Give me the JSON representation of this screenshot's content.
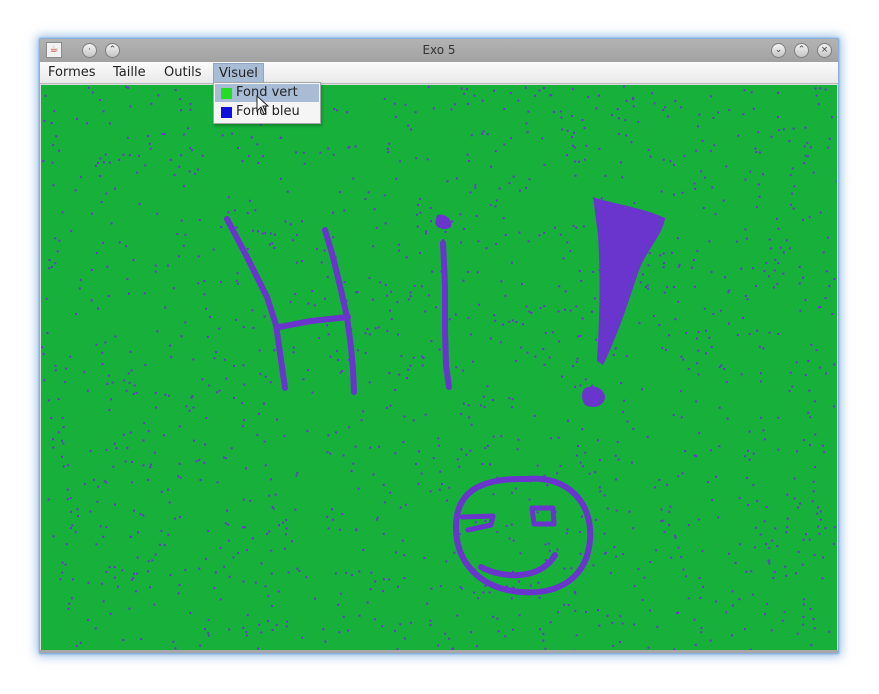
{
  "window": {
    "title": "Exo 5",
    "app_icon": "java-icon",
    "controls_left": [
      "window-menu-icon",
      "keep-above-icon"
    ],
    "controls_right": [
      "minimize-icon",
      "maximize-icon",
      "close-icon"
    ]
  },
  "menubar": {
    "items": [
      {
        "label": "Formes"
      },
      {
        "label": "Taille"
      },
      {
        "label": "Outils"
      },
      {
        "label": "Visuel",
        "active": true
      }
    ]
  },
  "dropdown": {
    "items": [
      {
        "label": "Fond vert",
        "swatch_color": "#22dd22",
        "highlighted": true
      },
      {
        "label": "Fond bleu",
        "swatch_color": "#1111dd",
        "highlighted": false
      }
    ]
  },
  "canvas": {
    "background_color": "#17b03a",
    "stroke_color": "#6a35cc",
    "drawing": "Hi! with a smiley face"
  },
  "colors": {
    "menu_highlight": "#a8bcd6",
    "titlebar": "#a9a9a9"
  }
}
